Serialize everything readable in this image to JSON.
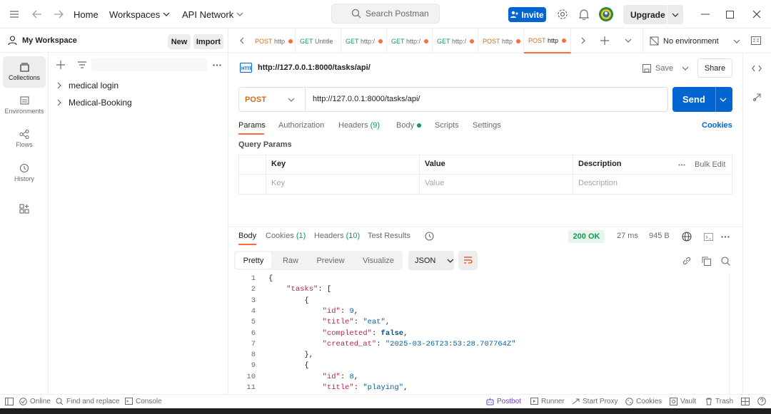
{
  "titlebar": {
    "home": "Home",
    "workspaces": "Workspaces",
    "api_network": "API Network",
    "search_placeholder": "Search Postman",
    "invite": "Invite",
    "upgrade": "Upgrade"
  },
  "sidebar": {
    "workspace_name": "My Workspace",
    "new_label": "New",
    "import_label": "Import",
    "rail": [
      {
        "label": "Collections"
      },
      {
        "label": "Environments"
      },
      {
        "label": "Flows"
      },
      {
        "label": "History"
      }
    ],
    "collections": [
      {
        "label": "medical login"
      },
      {
        "label": "Medical-Booking"
      }
    ]
  },
  "tabs": [
    {
      "method": "POST",
      "label": "http"
    },
    {
      "method": "GET",
      "label": "Untitle"
    },
    {
      "method": "GET",
      "label": "http:/"
    },
    {
      "method": "GET",
      "label": "http:/"
    },
    {
      "method": "GET",
      "label": "http:/"
    },
    {
      "method": "POST",
      "label": "http"
    },
    {
      "method": "POST",
      "label": "http"
    }
  ],
  "environment": "No environment",
  "request": {
    "title": "http://127.0.0.1:8000/tasks/api/",
    "save": "Save",
    "share": "Share",
    "method": "POST",
    "url": "http://127.0.0.1:8000/tasks/api/",
    "send": "Send",
    "tabs": [
      "Params",
      "Authorization",
      "Headers",
      "(9)",
      "Body",
      "Scripts",
      "Settings"
    ],
    "cookies": "Cookies",
    "query_params": "Query Params",
    "table": {
      "headers": [
        "Key",
        "Value",
        "Description"
      ],
      "bulk_edit": "Bulk Edit",
      "placeholders": [
        "Key",
        "Value",
        "Description"
      ]
    }
  },
  "response": {
    "tabs": [
      "Body",
      "Cookies",
      "(1)",
      "Headers",
      "(10)",
      "Test Results"
    ],
    "status": "200 OK",
    "time": "27 ms",
    "size": "945 B",
    "formats": [
      "Pretty",
      "Raw",
      "Preview",
      "Visualize"
    ],
    "language": "JSON",
    "lines": [
      {
        "n": "1",
        "t": "{"
      },
      {
        "n": "2",
        "t": "    \"tasks\": ["
      },
      {
        "n": "3",
        "t": "        {"
      },
      {
        "n": "4",
        "t": "            \"id\": 9,"
      },
      {
        "n": "5",
        "t": "            \"title\": \"eat\","
      },
      {
        "n": "6",
        "t": "            \"completed\": false,"
      },
      {
        "n": "7",
        "t": "            \"created_at\": \"2025-03-26T23:53:28.707764Z\""
      },
      {
        "n": "8",
        "t": "        },"
      },
      {
        "n": "9",
        "t": "        {"
      },
      {
        "n": "10",
        "t": "            \"id\": 8,"
      },
      {
        "n": "11",
        "t": "            \"title\": \"playing\","
      }
    ]
  },
  "footer": {
    "online": "Online",
    "find_replace": "Find and replace",
    "console": "Console",
    "postbot": "Postbot",
    "runner": "Runner",
    "start_proxy": "Start Proxy",
    "cookies": "Cookies",
    "vault": "Vault",
    "trash": "Trash"
  },
  "colors": {
    "accent": "#ff6c37",
    "primary": "#0265d2",
    "success": "#0a9f4f"
  }
}
